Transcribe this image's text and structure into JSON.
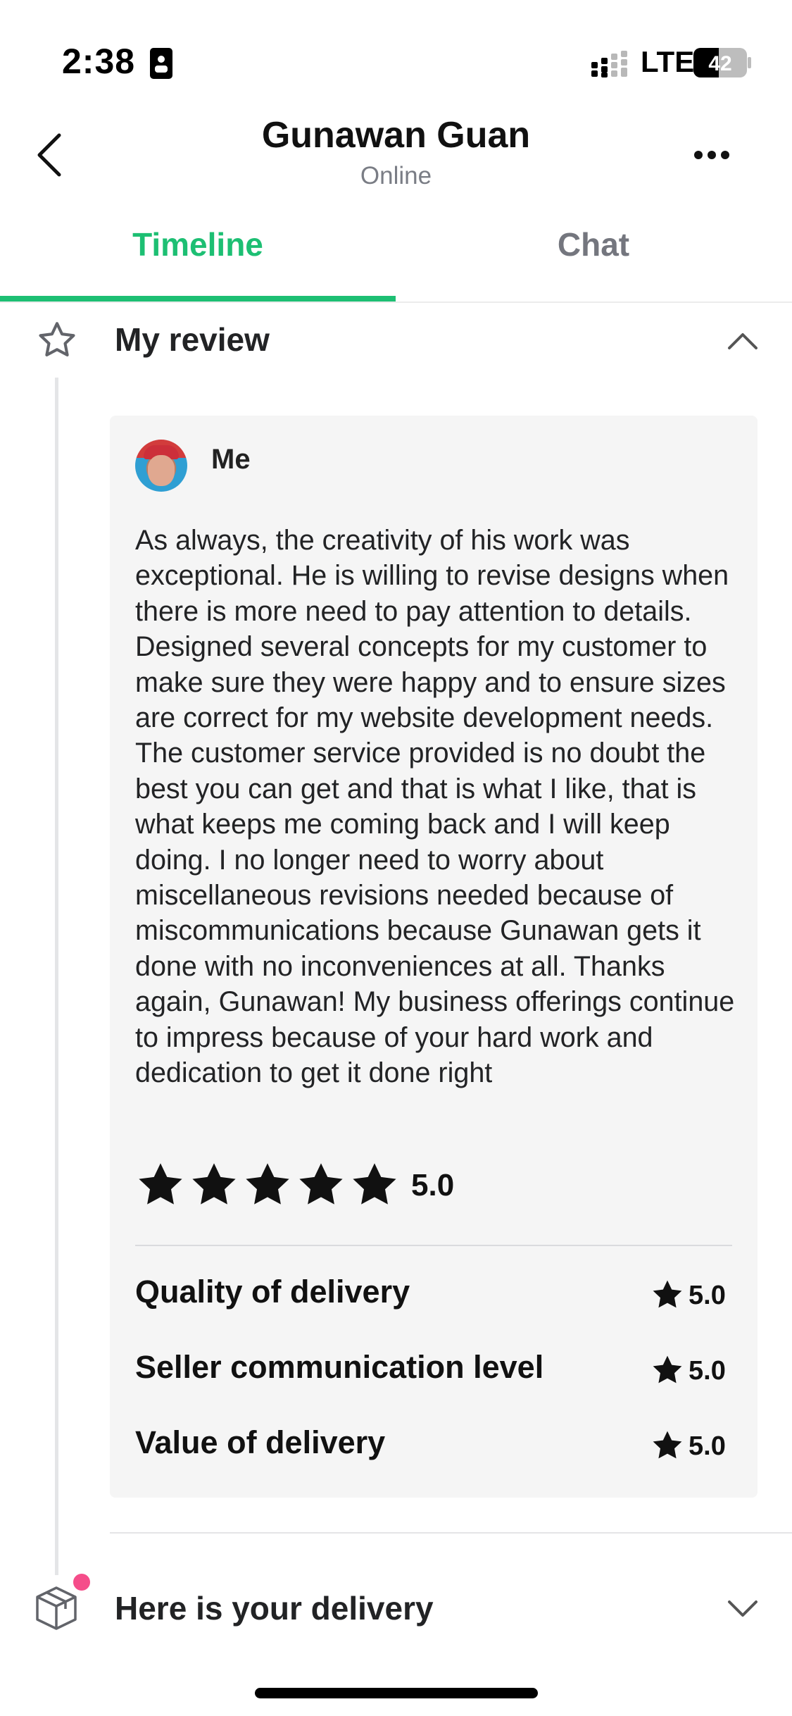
{
  "status_bar": {
    "time": "2:38",
    "network": "LTE",
    "battery": "42"
  },
  "header": {
    "title": "Gunawan Guan",
    "subtitle": "Online"
  },
  "tabs": [
    {
      "label": "Timeline",
      "active": true
    },
    {
      "label": "Chat",
      "active": false
    }
  ],
  "review_section": {
    "title": "My review",
    "reviewer_name": "Me",
    "text": "As always, the creativity of his work was exceptional. He is willing to revise designs when there is more need to pay attention to details. Designed several concepts for my customer to make sure they were happy and to ensure sizes are correct for my website development needs. The customer service provided is no doubt the best you can get and that is what I like, that is what keeps me coming back and I will keep doing. I no longer need to worry about miscellaneous revisions needed because of miscommunications because Gunawan gets it done with no inconveniences at all. Thanks again, Gunawan! My business offerings continue to impress because of your hard work and dedication to get it done right",
    "overall_rating": "5.0",
    "overall_stars": 5,
    "ratings": [
      {
        "label": "Quality of delivery",
        "value": "5.0"
      },
      {
        "label": "Seller communication level",
        "value": "5.0"
      },
      {
        "label": "Value of delivery",
        "value": "5.0"
      }
    ]
  },
  "delivery_section": {
    "title": "Here is your delivery"
  },
  "colors": {
    "accent": "#1dbf73",
    "muted": "#74767e",
    "card_bg": "#f5f5f5",
    "notification": "#f54d8a"
  }
}
